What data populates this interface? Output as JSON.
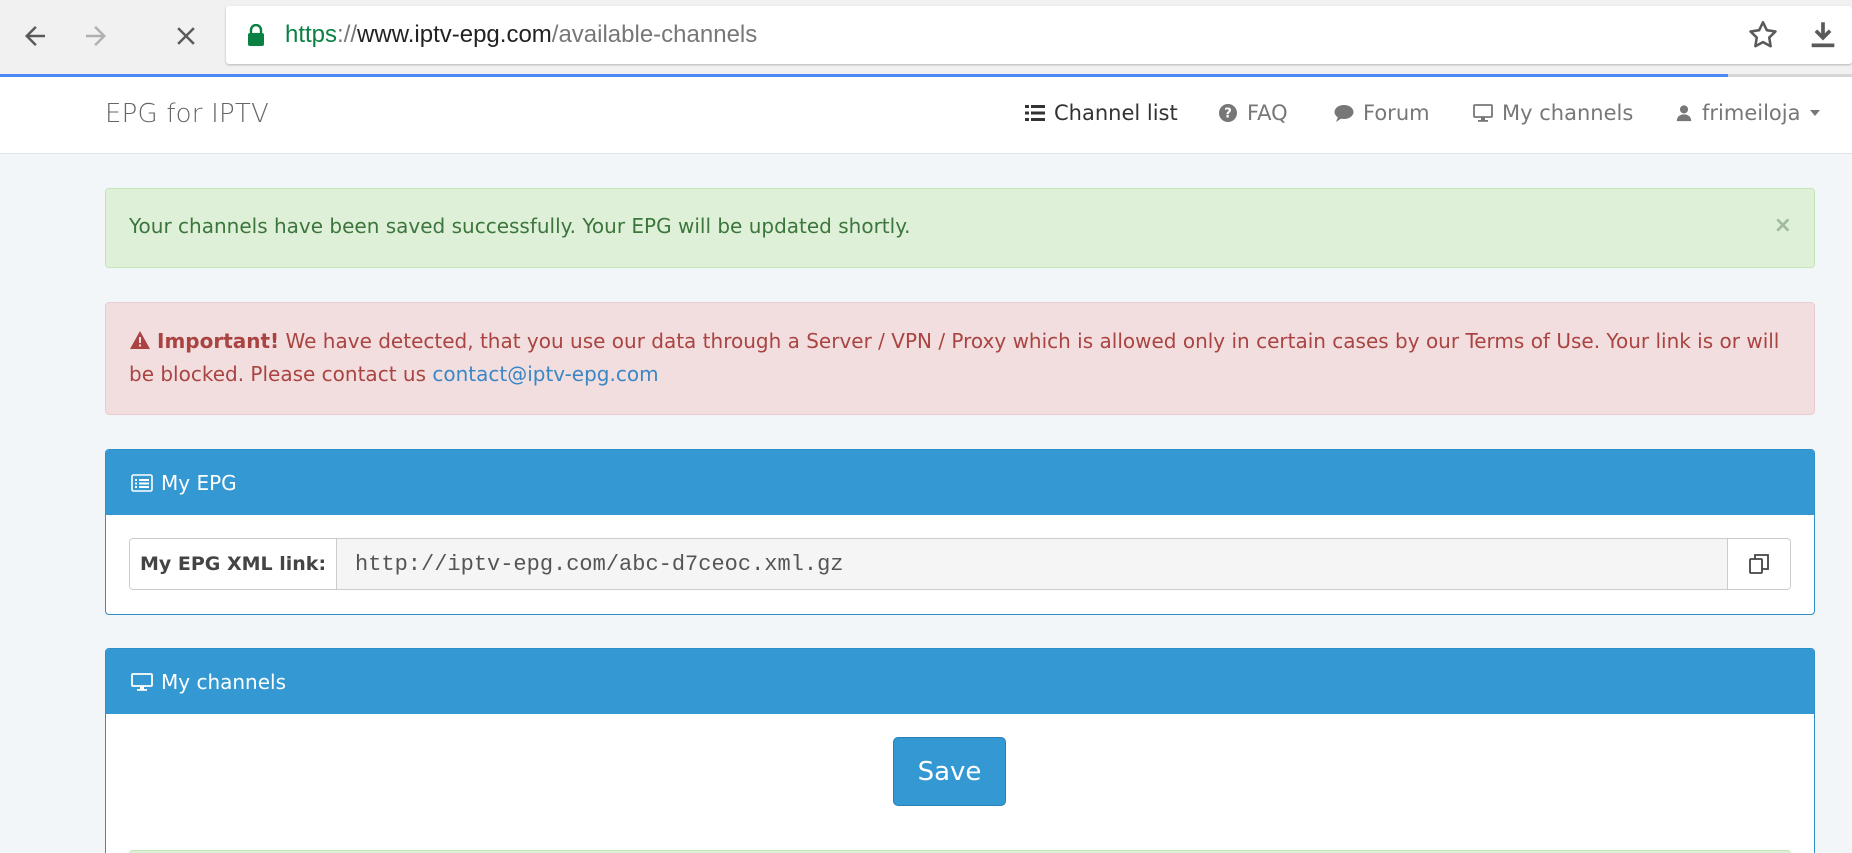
{
  "browser": {
    "url_scheme": "https",
    "url_sep": "://",
    "url_host": "www.iptv-epg.com",
    "url_path": "/available-channels",
    "accent": "#4c8bf5"
  },
  "navbar": {
    "brand": "EPG for IPTV",
    "items": [
      {
        "label": "Channel list",
        "icon": "list-icon"
      },
      {
        "label": "FAQ",
        "icon": "question-circle-icon"
      },
      {
        "label": "Forum",
        "icon": "comment-icon"
      },
      {
        "label": "My channels",
        "icon": "monitor-icon"
      },
      {
        "label": "frimeiloja",
        "icon": "user-icon"
      }
    ]
  },
  "alerts": {
    "success": {
      "text": "Your channels have been saved successfully. Your EPG will be updated shortly.",
      "close": "×"
    },
    "danger": {
      "strong": "Important!",
      "text": " We have detected, that you use our data through a Server / VPN / Proxy which is allowed only in certain cases by our Terms of Use. Your link is or will be blocked. Please contact us ",
      "link": "contact@iptv-epg.com"
    }
  },
  "epg_panel": {
    "title": "My EPG",
    "label": "My EPG XML link:",
    "value": "http://iptv-epg.com/abc-d7ceoc.xml.gz"
  },
  "channels_panel": {
    "title": "My channels",
    "save_label": "Save"
  },
  "colors": {
    "primary": "#3498d3",
    "success_bg": "#dff0d8",
    "danger_bg": "#f2dede"
  }
}
